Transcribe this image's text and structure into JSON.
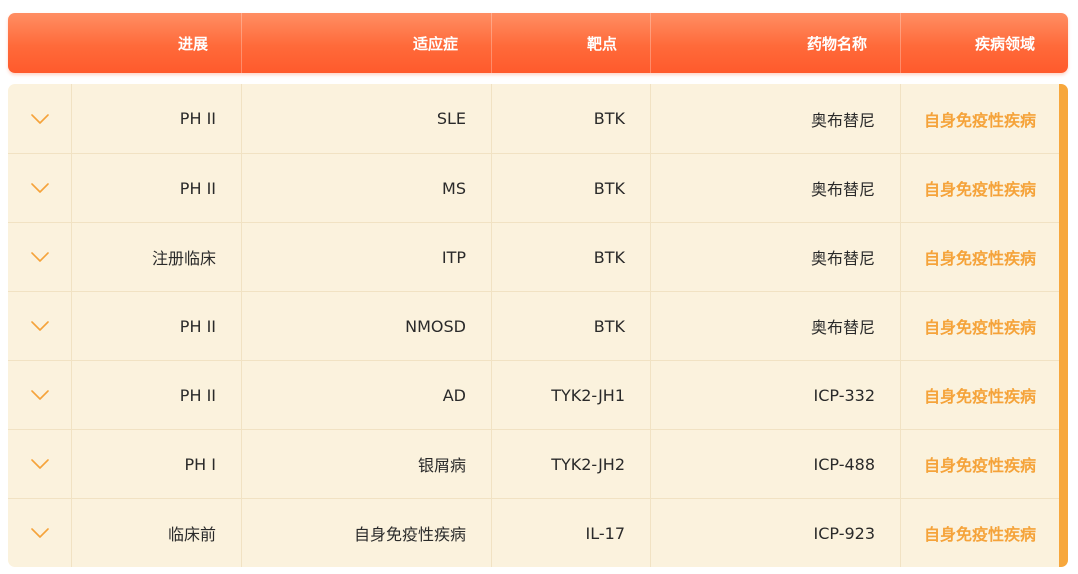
{
  "table": {
    "headers": {
      "area": "疾病领域",
      "drug": "药物名称",
      "target": "靶点",
      "indication": "适应症",
      "progress": "进展"
    },
    "rows": [
      {
        "area": "自身免疫性疾病",
        "drug": "奥布替尼",
        "target": "BTK",
        "indication": "SLE",
        "progress": "PH II"
      },
      {
        "area": "自身免疫性疾病",
        "drug": "奥布替尼",
        "target": "BTK",
        "indication": "MS",
        "progress": "PH II"
      },
      {
        "area": "自身免疫性疾病",
        "drug": "奥布替尼",
        "target": "BTK",
        "indication": "ITP",
        "progress": "注册临床"
      },
      {
        "area": "自身免疫性疾病",
        "drug": "奥布替尼",
        "target": "BTK",
        "indication": "NMOSD",
        "progress": "PH II"
      },
      {
        "area": "自身免疫性疾病",
        "drug": "ICP-332",
        "target": "TYK2-JH1",
        "indication": "AD",
        "progress": "PH II"
      },
      {
        "area": "自身免疫性疾病",
        "drug": "ICP-488",
        "target": "TYK2-JH2",
        "indication": "银屑病",
        "progress": "PH I"
      },
      {
        "area": "自身免疫性疾病",
        "drug": "ICP-923",
        "target": "IL-17",
        "indication": "自身免疫性疾病",
        "progress": "临床前"
      }
    ]
  },
  "icons": {
    "expand": "chevron-down-icon"
  },
  "colors": {
    "header_gradient_top": "#ff8e63",
    "header_gradient_bottom": "#ff5a2c",
    "row_background": "#fbf2dd",
    "area_text": "#f5a33a",
    "accent_bar": "#f7a73c",
    "chevron": "#f5a33a"
  }
}
